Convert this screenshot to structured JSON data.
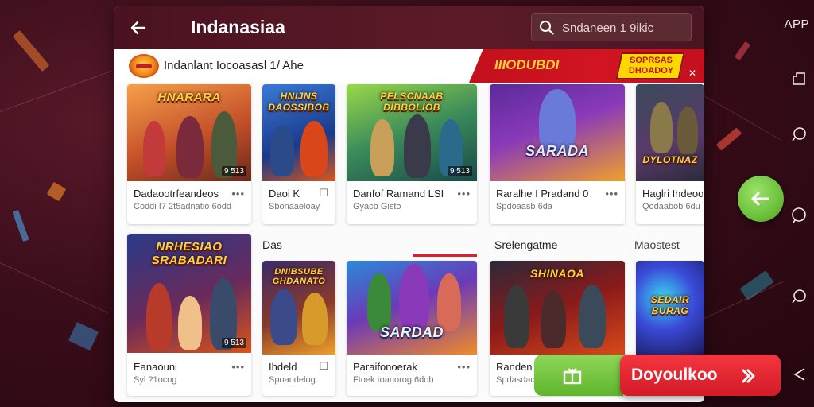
{
  "app": {
    "title": "Indanasiaa",
    "rail_label": "APP"
  },
  "search": {
    "placeholder": "Sndaneen 1 9ikic"
  },
  "banner": {
    "text": "Indanlant Iocoasasl 1/ Ahe",
    "ad_left": "IIIODUBDI",
    "ad_right": "SOPRSAS DHOADOY"
  },
  "row1": [
    {
      "thumb_title": "HNARARA",
      "name": "Dadaootrfeandeos",
      "sub": "Coddi I7 2t5adnatio 6odd",
      "count": "9 513",
      "more": "•••"
    },
    {
      "thumb_title": "HNIJNS DAOSSIBOB",
      "name": "Daoi K",
      "sub": "Sbonaaeloay",
      "more": "☐"
    },
    {
      "thumb_title": "PELSCNAAB DIBBOLIOB",
      "name": "Danfof Ramand LSI",
      "sub": "Gyacb Gisto",
      "count": "9 513",
      "more": "•••"
    },
    {
      "thumb_title": "SARADA",
      "name": "Raralhe I Pradand 0",
      "sub": "Spdoaasb 6da",
      "more": "•••"
    },
    {
      "thumb_title": "DYLOTNAZ",
      "name": "Haglri Ihdeood",
      "sub": "Qodaabob 6du",
      "more": ""
    }
  ],
  "row2": {
    "labels": {
      "left": "Das",
      "mid": "Srelengatme",
      "right": "Maostest"
    },
    "items": [
      {
        "thumb_title": "NRHESIAO SRABADARI",
        "name": "Eanaouni",
        "sub": "Syl ?1ocog",
        "count": "9 513",
        "more": "•••"
      },
      {
        "thumb_title": "DNIBSUBE GHDANATO",
        "name": "Ihdeld",
        "sub": "Spoandelog",
        "more": "☐"
      },
      {
        "thumb_title": "SARDAD",
        "name": "Paraifonoerak",
        "sub": "Ftoek toanorog 6dob",
        "more": "•••"
      },
      {
        "thumb_title": "SHINAOA",
        "name": "Randen I",
        "sub": "Spdasdacog",
        "more": "•••"
      },
      {
        "thumb_title": "SEDAIR BURAG",
        "name": "",
        "sub": "",
        "more": ""
      }
    ]
  },
  "download": {
    "label": "Doyoulkoo"
  },
  "colors": {
    "brand": "#4a1220",
    "accent_red": "#d31a26",
    "accent_green": "#6cc23c",
    "ad_yellow": "#ffd700"
  }
}
